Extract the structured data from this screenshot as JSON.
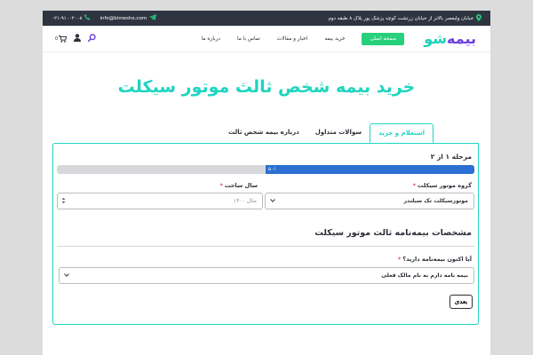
{
  "topbar": {
    "address": "خیابان ولیعصر بالاتر از خیابان زرتشت کوچه پزشک پور پلاک ۸ طبقه دوم",
    "email": "info@bimesho.com",
    "phone": "۰۲۱-۹۱۰۰۲۰۰۸"
  },
  "nav": {
    "logo_main": "بیمه",
    "logo_sub": "شو",
    "items": [
      "صفحه اصلی",
      "خرید بیمه",
      "اخبار و مقالات",
      "تماس با ما",
      "درباره ما"
    ],
    "cart_count": "0"
  },
  "page": {
    "title": "خرید بیمه شخص ثالث موتور سیکلت"
  },
  "tabs": [
    "استعلام و خرید",
    "سوالات متداول",
    "درباره بیمه شخص ثالث"
  ],
  "form": {
    "step_label": "مرحله ۱ از ۲",
    "progress_text": "۵۰٪",
    "progress_fraction": 0.5,
    "group_label": "گروه موتور سیکلت",
    "group_value": "موتورسیکلت تک سیلندر",
    "year_label": "سال ساخت",
    "year_placeholder": "مثال ۱۴۰۰",
    "section_title": "مشخصات بیمه‌نامه ثالث موتور سیکلت",
    "policy_label": "آیا اکنون بیمه‌نامه دارید؟",
    "policy_value": "بیمه نامه دارم به نام مالک فعلی",
    "next_label": "بعدی",
    "required_mark": "*"
  },
  "colors": {
    "accent": "#1ed5c0",
    "brand": "#6c3fe0",
    "active_menu": "#27d07a",
    "progress": "#2a6fd1",
    "topbar": "#2e3540"
  },
  "icons": {
    "address": "location-pin-icon",
    "email": "paper-plane-icon",
    "phone": "phone-icon",
    "search": "search-icon",
    "user": "user-icon",
    "cart": "cart-icon"
  }
}
